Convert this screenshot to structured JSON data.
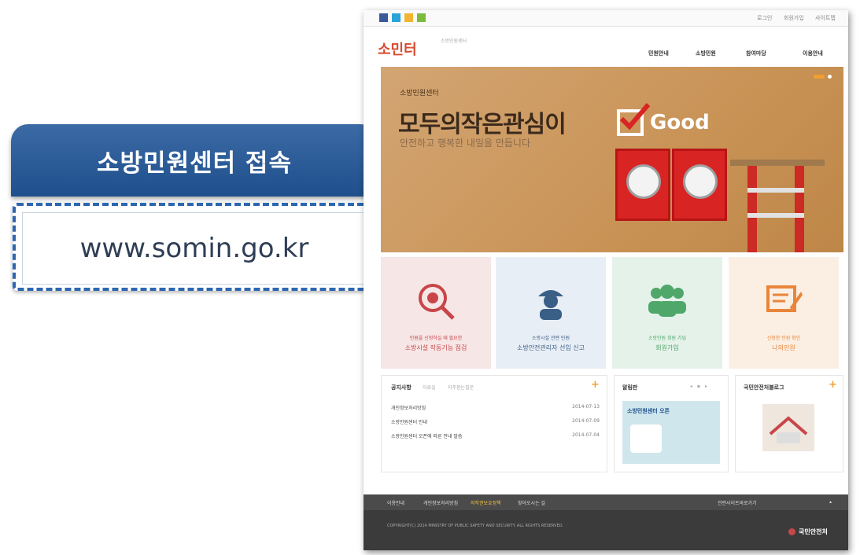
{
  "callout": {
    "title": "소방민원센터 접속",
    "url": "www.somin.go.kr"
  },
  "site": {
    "utility_links": [
      "로그인",
      "회원가입",
      "사이트맵"
    ],
    "logo_text": "소민터",
    "logo_sub": "소방민원센터",
    "nav": [
      "민원안내",
      "소방민원",
      "참여마당",
      "이용안내"
    ],
    "hero": {
      "small": "소방민원센터",
      "title": "모두의작은관심이",
      "subtitle": "안전하고 행복한 내일을 만듭니다",
      "badge": "Good"
    },
    "tiles": [
      {
        "line1": "민원을 신청하실 때 필요한",
        "line2": "소방시설 작동기능 점검",
        "bg": "#f7e6e6",
        "fg": "#c8464a"
      },
      {
        "line1": "소방시설 관련 민원",
        "line2": "소방안전관리자 선임 신고",
        "bg": "#e8eef5",
        "fg": "#3a5f86"
      },
      {
        "line1": "소방민원 회원 가입",
        "line2": "회원가입",
        "bg": "#e5f2ea",
        "fg": "#4fa86a"
      },
      {
        "line1": "신청한 민원 확인",
        "line2": "나의민원",
        "bg": "#fbefe3",
        "fg": "#e8853b"
      }
    ],
    "notice": {
      "title": "공지사항",
      "tabs": [
        "자료실",
        "자주묻는질문"
      ],
      "rows": [
        {
          "text": "개인정보처리방침",
          "date": "2014-07-13"
        },
        {
          "text": "소방민원센터 안내",
          "date": "2014-07-09"
        },
        {
          "text": "소방민원센터 오픈에 따른 안내 말씀",
          "date": "2014-07-04"
        }
      ]
    },
    "popup": {
      "title": "알림판",
      "banner": "소방민원센터 오픈"
    },
    "blog": {
      "title": "국민안전처블로그"
    },
    "footer": {
      "links": [
        "이용안내",
        "개인정보처리방침",
        "저작권보호정책",
        "찾아오시는 길"
      ],
      "related": "관련사이트바로가기",
      "copyright": "COPYRIGHT(C) 2014 MINISTRY OF PUBLIC SAFETY AND SECURITY. ALL RIGHTS RESERVED.",
      "org": "국민안전처"
    }
  },
  "colors": {
    "callout_header": "#2a5b98",
    "url_frame": "#2e67b1",
    "hero_bg": "#c99356",
    "footer_bg": "#3b3b3b"
  }
}
